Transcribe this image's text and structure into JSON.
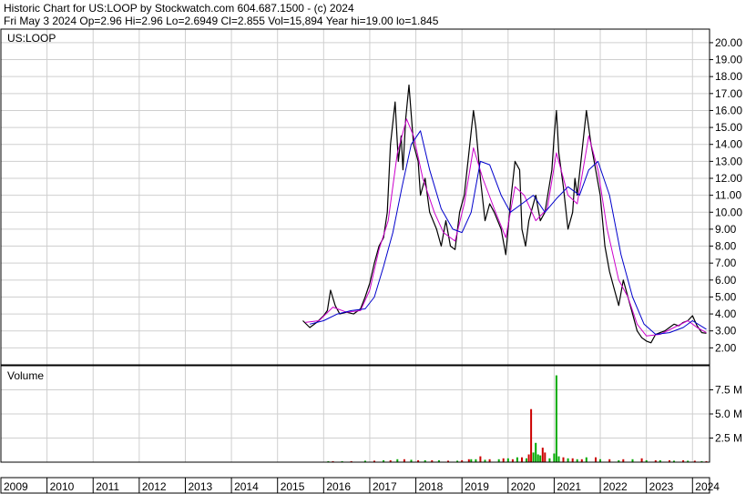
{
  "header": {
    "line1": "Historic Chart for US:LOOP by Stockwatch.com 604.687.1500 - (c) 2024",
    "line2": "Fri May  3 2024   Op=2.96   Hi=2.96   Lo=2.6949   Cl=2.855   Vol=15,894   Year hi=19.00   lo=1.845"
  },
  "chart_data": [
    {
      "type": "line",
      "title": "US:LOOP",
      "y_ticks": [
        "20.00",
        "19.00",
        "18.00",
        "17.00",
        "16.00",
        "15.00",
        "14.00",
        "13.00",
        "12.00",
        "11.00",
        "10.00",
        "9.00",
        "8.00",
        "7.00",
        "6.00",
        "5.00",
        "4.00",
        "3.00",
        "2.00"
      ],
      "ylim": [
        1.0,
        20.8
      ],
      "x_ticks": [
        "2009",
        "2010",
        "2011",
        "2012",
        "2013",
        "2014",
        "2015",
        "2016",
        "2017",
        "2018",
        "2019",
        "2020",
        "2021",
        "2022",
        "2023",
        "2024"
      ],
      "xlim": [
        2009.0,
        2024.37
      ],
      "grid": true,
      "series": [
        {
          "color": "#000000",
          "x": [
            2015.55,
            2015.7,
            2015.85,
            2016.0,
            2016.08,
            2016.15,
            2016.25,
            2016.35,
            2016.5,
            2016.65,
            2016.8,
            2016.9,
            2017.0,
            2017.1,
            2017.2,
            2017.3,
            2017.38,
            2017.45,
            2017.55,
            2017.62,
            2017.68,
            2017.72,
            2017.78,
            2017.85,
            2017.95,
            2018.05,
            2018.1,
            2018.2,
            2018.3,
            2018.45,
            2018.55,
            2018.65,
            2018.75,
            2018.85,
            2018.95,
            2019.05,
            2019.15,
            2019.25,
            2019.3,
            2019.4,
            2019.5,
            2019.6,
            2019.7,
            2019.85,
            2019.95,
            2020.05,
            2020.15,
            2020.25,
            2020.3,
            2020.38,
            2020.45,
            2020.5,
            2020.6,
            2020.7,
            2020.8,
            2020.95,
            2021.0,
            2021.05,
            2021.1,
            2021.2,
            2021.3,
            2021.4,
            2021.45,
            2021.5,
            2021.6,
            2021.7,
            2021.8,
            2021.9,
            2022.0,
            2022.1,
            2022.2,
            2022.3,
            2022.4,
            2022.5,
            2022.6,
            2022.7,
            2022.8,
            2022.9,
            2023.0,
            2023.1,
            2023.2,
            2023.3,
            2023.4,
            2023.5,
            2023.6,
            2023.7,
            2023.8,
            2023.9,
            2024.0,
            2024.1,
            2024.2,
            2024.3
          ],
          "y": [
            3.6,
            3.2,
            3.5,
            3.9,
            4.2,
            5.4,
            4.5,
            4.0,
            4.1,
            4.0,
            4.3,
            5.0,
            5.8,
            7.0,
            8.0,
            8.5,
            10.0,
            14.0,
            16.5,
            13.0,
            14.5,
            12.5,
            15.5,
            17.5,
            14.0,
            13.0,
            11.0,
            12.0,
            10.0,
            9.0,
            8.0,
            9.5,
            8.0,
            7.8,
            10.0,
            11.0,
            13.5,
            16.0,
            15.0,
            12.0,
            9.5,
            10.5,
            10.0,
            9.0,
            7.5,
            10.5,
            13.0,
            12.5,
            9.0,
            8.0,
            9.5,
            10.0,
            11.0,
            9.5,
            10.0,
            12.5,
            14.5,
            16.0,
            13.5,
            11.5,
            9.0,
            10.0,
            12.0,
            11.0,
            13.5,
            16.0,
            14.0,
            12.5,
            11.0,
            8.0,
            6.5,
            5.5,
            4.5,
            6.0,
            5.0,
            4.0,
            3.0,
            2.6,
            2.4,
            2.3,
            2.8,
            2.9,
            3.0,
            3.2,
            3.4,
            3.3,
            3.5,
            3.6,
            3.9,
            3.3,
            2.9,
            2.86
          ]
        },
        {
          "color": "#cc00cc",
          "x": [
            2015.6,
            2015.9,
            2016.2,
            2016.5,
            2016.8,
            2017.0,
            2017.2,
            2017.4,
            2017.6,
            2017.8,
            2017.95,
            2018.15,
            2018.4,
            2018.6,
            2018.85,
            2019.05,
            2019.25,
            2019.45,
            2019.7,
            2019.95,
            2020.15,
            2020.35,
            2020.6,
            2020.85,
            2021.05,
            2021.3,
            2021.5,
            2021.75,
            2021.95,
            2022.15,
            2022.4,
            2022.6,
            2022.8,
            2023.0,
            2023.3,
            2023.6,
            2023.9,
            2024.1,
            2024.3
          ],
          "y": [
            3.5,
            3.6,
            4.4,
            4.1,
            4.2,
            5.4,
            7.8,
            9.5,
            13.5,
            15.5,
            14.5,
            12.0,
            10.0,
            8.8,
            8.3,
            10.5,
            13.8,
            12.0,
            10.2,
            8.5,
            11.5,
            11.0,
            9.5,
            10.2,
            13.5,
            11.0,
            10.5,
            14.5,
            12.5,
            9.0,
            6.0,
            5.0,
            3.4,
            2.7,
            2.8,
            3.2,
            3.6,
            3.2,
            2.9
          ]
        },
        {
          "color": "#0000cc",
          "x": [
            2015.7,
            2016.0,
            2016.3,
            2016.6,
            2016.9,
            2017.1,
            2017.3,
            2017.5,
            2017.7,
            2017.9,
            2018.1,
            2018.3,
            2018.55,
            2018.8,
            2019.0,
            2019.2,
            2019.4,
            2019.6,
            2019.85,
            2020.05,
            2020.3,
            2020.55,
            2020.8,
            2021.05,
            2021.3,
            2021.55,
            2021.75,
            2021.95,
            2022.2,
            2022.45,
            2022.7,
            2022.95,
            2023.2,
            2023.5,
            2023.8,
            2024.0,
            2024.3
          ],
          "y": [
            3.4,
            3.6,
            4.0,
            4.2,
            4.3,
            5.0,
            6.8,
            8.8,
            11.5,
            14.0,
            14.8,
            12.5,
            10.2,
            9.0,
            8.8,
            10.0,
            13.0,
            12.8,
            11.0,
            10.0,
            10.5,
            11.0,
            10.0,
            10.8,
            11.5,
            11.0,
            12.5,
            13.0,
            11.0,
            7.5,
            5.0,
            3.4,
            2.8,
            2.9,
            3.2,
            3.6,
            3.1
          ]
        }
      ]
    },
    {
      "type": "bar",
      "title": "Volume",
      "y_ticks": [
        "7.5 M",
        "5.0 M",
        "2.5 M"
      ],
      "ylim": [
        0,
        10.0
      ],
      "y_unit": "M",
      "xlim": [
        2009.0,
        2024.37
      ],
      "grid": true,
      "series": [
        {
          "color": "#00aa00",
          "x": [
            2016.1,
            2016.4,
            2016.9,
            2017.3,
            2017.6,
            2017.9,
            2018.2,
            2018.5,
            2018.9,
            2019.2,
            2019.3,
            2019.5,
            2019.8,
            2020.0,
            2020.2,
            2020.4,
            2020.55,
            2020.6,
            2020.65,
            2020.7,
            2020.9,
            2021.0,
            2021.05,
            2021.1,
            2021.3,
            2021.5,
            2021.7,
            2022.0,
            2022.4,
            2022.7,
            2023.0,
            2023.3,
            2023.6,
            2023.9,
            2024.2
          ],
          "y": [
            0.1,
            0.1,
            0.15,
            0.2,
            0.3,
            0.25,
            0.2,
            0.2,
            0.15,
            0.3,
            0.3,
            0.25,
            0.3,
            0.4,
            0.5,
            0.4,
            1.0,
            2.0,
            0.8,
            0.7,
            0.4,
            0.9,
            9.0,
            0.6,
            0.4,
            0.3,
            0.5,
            0.3,
            0.2,
            0.3,
            0.2,
            0.2,
            0.15,
            0.15,
            0.1
          ]
        },
        {
          "color": "#cc0000",
          "x": [
            2016.2,
            2016.6,
            2017.1,
            2017.45,
            2017.75,
            2018.05,
            2018.35,
            2018.7,
            2019.0,
            2019.15,
            2019.4,
            2019.6,
            2019.9,
            2020.1,
            2020.3,
            2020.45,
            2020.5,
            2020.75,
            2020.8,
            2021.2,
            2021.4,
            2021.6,
            2021.9,
            2022.2,
            2022.5,
            2022.9,
            2023.2,
            2023.5,
            2023.8,
            2024.05,
            2024.3
          ],
          "y": [
            0.1,
            0.1,
            0.15,
            0.2,
            0.3,
            0.2,
            0.2,
            0.15,
            0.2,
            0.3,
            0.6,
            0.3,
            0.4,
            0.3,
            0.5,
            0.8,
            5.5,
            1.5,
            1.0,
            0.5,
            0.4,
            0.3,
            0.5,
            0.3,
            0.3,
            0.4,
            0.2,
            0.2,
            0.2,
            0.15,
            0.1
          ]
        }
      ]
    }
  ]
}
